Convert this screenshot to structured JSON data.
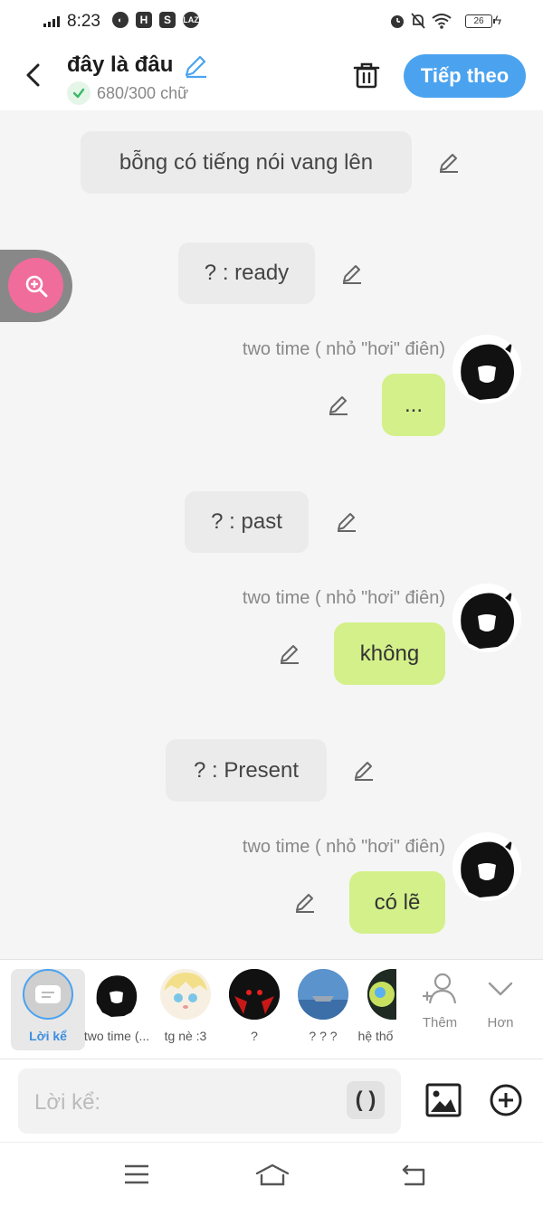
{
  "status_bar": {
    "time": "8:23",
    "left_icons": [
      "globe-icon",
      "h-icon",
      "shop-icon",
      "laz-icon"
    ],
    "h_label": "H",
    "shop_label": "S",
    "laz_label": "LAZ",
    "right_icons": [
      "alarm-icon",
      "mute-icon",
      "wifi-icon",
      "battery-icon",
      "charging-icon"
    ],
    "battery": "26"
  },
  "header": {
    "title": "đây là đâu",
    "word_count": "680/300 chữ",
    "next_label": "Tiếp theo"
  },
  "messages": [
    {
      "type": "narration",
      "text": "bỗng có tiếng nói vang lên"
    },
    {
      "type": "narration",
      "text": "? : ready"
    },
    {
      "type": "character",
      "sender": "two time ( nhỏ \"hơi\" điên)",
      "text": "..."
    },
    {
      "type": "narration",
      "text": "? : past"
    },
    {
      "type": "character",
      "sender": "two time ( nhỏ \"hơi\" điên)",
      "text": "không"
    },
    {
      "type": "narration",
      "text": "? : Present"
    },
    {
      "type": "character",
      "sender": "two time ( nhỏ \"hơi\" điên)",
      "text": "có lẽ"
    }
  ],
  "characters": [
    {
      "name": "Lời kể",
      "selected": true
    },
    {
      "name": "two time (..."
    },
    {
      "name": "tg nè :3"
    },
    {
      "name": "?"
    },
    {
      "name": "? ? ?"
    },
    {
      "name": "hệ thố"
    }
  ],
  "char_actions": {
    "add_label": "Thêm",
    "more_label": "Hơn"
  },
  "input": {
    "placeholder": "Lời kể:",
    "paren_label": "( )"
  },
  "colors": {
    "accent": "#4ba3ef",
    "bubble": "#d4f08a",
    "zoom": "#f06c9b"
  }
}
